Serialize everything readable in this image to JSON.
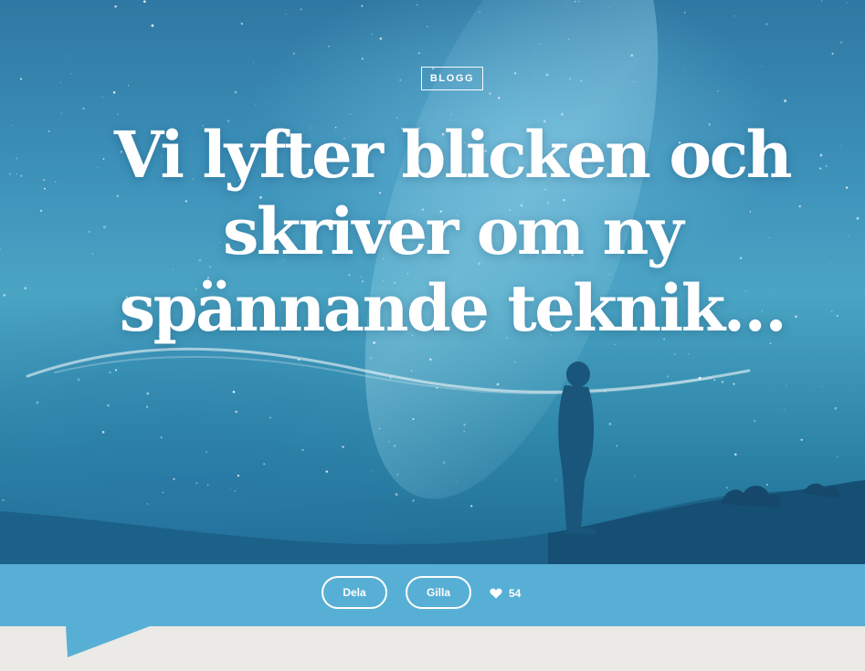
{
  "hero": {
    "category": "BLOGG",
    "title": "Vi lyfter blicken och skriver om ny spännande teknik…"
  },
  "actions": {
    "share_label": "Dela",
    "like_label": "Gilla",
    "like_count": "54"
  },
  "icons": {
    "like": "heart-icon"
  },
  "colors": {
    "action_bar": "#58afd5",
    "page_background": "#ebeae6"
  }
}
